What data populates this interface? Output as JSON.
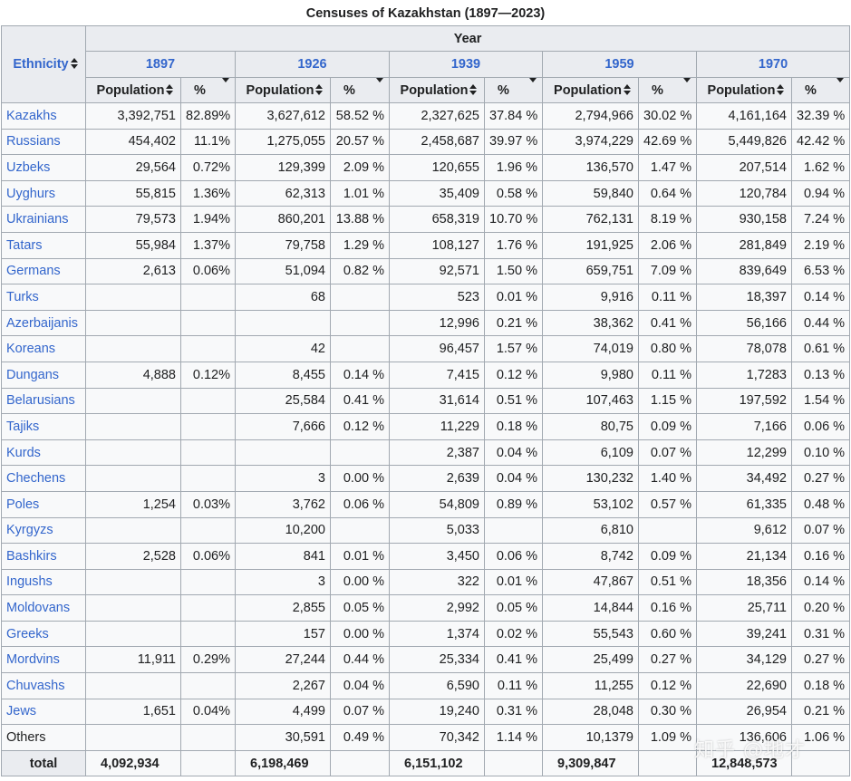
{
  "caption": "Censuses of Kazakhstan (1897—2023)",
  "header": {
    "ethnicity": "Ethnicity",
    "year": "Year",
    "years": [
      "1897",
      "1926",
      "1939",
      "1959",
      "1970"
    ],
    "population": "Population",
    "percent": "%"
  },
  "rows": [
    {
      "name": "Kazakhs",
      "v": [
        "3,392,751",
        "82.89%",
        "3,627,612",
        "58.52 %",
        "2,327,625",
        "37.84 %",
        "2,794,966",
        "30.02 %",
        "4,161,164",
        "32.39 %"
      ]
    },
    {
      "name": "Russians",
      "v": [
        "454,402",
        "11.1%",
        "1,275,055",
        "20.57 %",
        "2,458,687",
        "39.97 %",
        "3,974,229",
        "42.69 %",
        "5,449,826",
        "42.42 %"
      ]
    },
    {
      "name": "Uzbeks",
      "v": [
        "29,564",
        "0.72%",
        "129,399",
        "2.09 %",
        "120,655",
        "1.96 %",
        "136,570",
        "1.47 %",
        "207,514",
        "1.62 %"
      ]
    },
    {
      "name": "Uyghurs",
      "v": [
        "55,815",
        "1.36%",
        "62,313",
        "1.01 %",
        "35,409",
        "0.58 %",
        "59,840",
        "0.64 %",
        "120,784",
        "0.94 %"
      ]
    },
    {
      "name": "Ukrainians",
      "v": [
        "79,573",
        "1.94%",
        "860,201",
        "13.88 %",
        "658,319",
        "10.70 %",
        "762,131",
        "8.19 %",
        "930,158",
        "7.24 %"
      ]
    },
    {
      "name": "Tatars",
      "v": [
        "55,984",
        "1.37%",
        "79,758",
        "1.29 %",
        "108,127",
        "1.76 %",
        "191,925",
        "2.06 %",
        "281,849",
        "2.19 %"
      ]
    },
    {
      "name": "Germans",
      "v": [
        "2,613",
        "0.06%",
        "51,094",
        "0.82 %",
        "92,571",
        "1.50 %",
        "659,751",
        "7.09 %",
        "839,649",
        "6.53 %"
      ]
    },
    {
      "name": "Turks",
      "v": [
        "",
        "",
        "68",
        "",
        "523",
        "0.01 %",
        "9,916",
        "0.11 %",
        "18,397",
        "0.14 %"
      ]
    },
    {
      "name": "Azerbaijanis",
      "v": [
        "",
        "",
        "",
        "",
        "12,996",
        "0.21 %",
        "38,362",
        "0.41 %",
        "56,166",
        "0.44 %"
      ]
    },
    {
      "name": "Koreans",
      "v": [
        "",
        "",
        "42",
        "",
        "96,457",
        "1.57 %",
        "74,019",
        "0.80 %",
        "78,078",
        "0.61 %"
      ]
    },
    {
      "name": "Dungans",
      "v": [
        "4,888",
        "0.12%",
        "8,455",
        "0.14 %",
        "7,415",
        "0.12 %",
        "9,980",
        "0.11 %",
        "1,7283",
        "0.13 %"
      ]
    },
    {
      "name": "Belarusians",
      "v": [
        "",
        "",
        "25,584",
        "0.41 %",
        "31,614",
        "0.51 %",
        "107,463",
        "1.15 %",
        "197,592",
        "1.54 %"
      ]
    },
    {
      "name": "Tajiks",
      "v": [
        "",
        "",
        "7,666",
        "0.12 %",
        "11,229",
        "0.18 %",
        "80,75",
        "0.09 %",
        "7,166",
        "0.06 %"
      ]
    },
    {
      "name": "Kurds",
      "v": [
        "",
        "",
        "",
        "",
        "2,387",
        "0.04 %",
        "6,109",
        "0.07 %",
        "12,299",
        "0.10 %"
      ]
    },
    {
      "name": "Chechens",
      "v": [
        "",
        "",
        "3",
        "0.00 %",
        "2,639",
        "0.04 %",
        "130,232",
        "1.40 %",
        "34,492",
        "0.27 %"
      ]
    },
    {
      "name": "Poles",
      "v": [
        "1,254",
        "0.03%",
        "3,762",
        "0.06 %",
        "54,809",
        "0.89 %",
        "53,102",
        "0.57 %",
        "61,335",
        "0.48 %"
      ]
    },
    {
      "name": "Kyrgyzs",
      "v": [
        "",
        "",
        "10,200",
        "",
        "5,033",
        "",
        "6,810",
        "",
        "9,612",
        "0.07 %"
      ]
    },
    {
      "name": "Bashkirs",
      "v": [
        "2,528",
        "0.06%",
        "841",
        "0.01 %",
        "3,450",
        "0.06 %",
        "8,742",
        "0.09 %",
        "21,134",
        "0.16 %"
      ]
    },
    {
      "name": "Ingushs",
      "v": [
        "",
        "",
        "3",
        "0.00 %",
        "322",
        "0.01 %",
        "47,867",
        "0.51 %",
        "18,356",
        "0.14 %"
      ]
    },
    {
      "name": "Moldovans",
      "v": [
        "",
        "",
        "2,855",
        "0.05 %",
        "2,992",
        "0.05 %",
        "14,844",
        "0.16 %",
        "25,711",
        "0.20 %"
      ]
    },
    {
      "name": "Greeks",
      "v": [
        "",
        "",
        "157",
        "0.00 %",
        "1,374",
        "0.02 %",
        "55,543",
        "0.60 %",
        "39,241",
        "0.31 %"
      ]
    },
    {
      "name": "Mordvins",
      "v": [
        "11,911",
        "0.29%",
        "27,244",
        "0.44 %",
        "25,334",
        "0.41 %",
        "25,499",
        "0.27 %",
        "34,129",
        "0.27 %"
      ]
    },
    {
      "name": "Chuvashs",
      "v": [
        "",
        "",
        "2,267",
        "0.04 %",
        "6,590",
        "0.11 %",
        "11,255",
        "0.12 %",
        "22,690",
        "0.18 %"
      ]
    },
    {
      "name": "Jews",
      "v": [
        "1,651",
        "0.04%",
        "4,499",
        "0.07 %",
        "19,240",
        "0.31 %",
        "28,048",
        "0.30 %",
        "26,954",
        "0.21 %"
      ]
    },
    {
      "name": "Others",
      "plain": true,
      "v": [
        "",
        "",
        "30,591",
        "0.49 %",
        "70,342",
        "1.14 %",
        "10,1379",
        "1.09 %",
        "136,606",
        "1.06 %"
      ]
    }
  ],
  "total": {
    "label": "total",
    "v": [
      "4,092,934",
      "6,198,469",
      "6,151,102",
      "9,309,847",
      "12,848,573"
    ]
  },
  "watermark": "知乎 @地才"
}
